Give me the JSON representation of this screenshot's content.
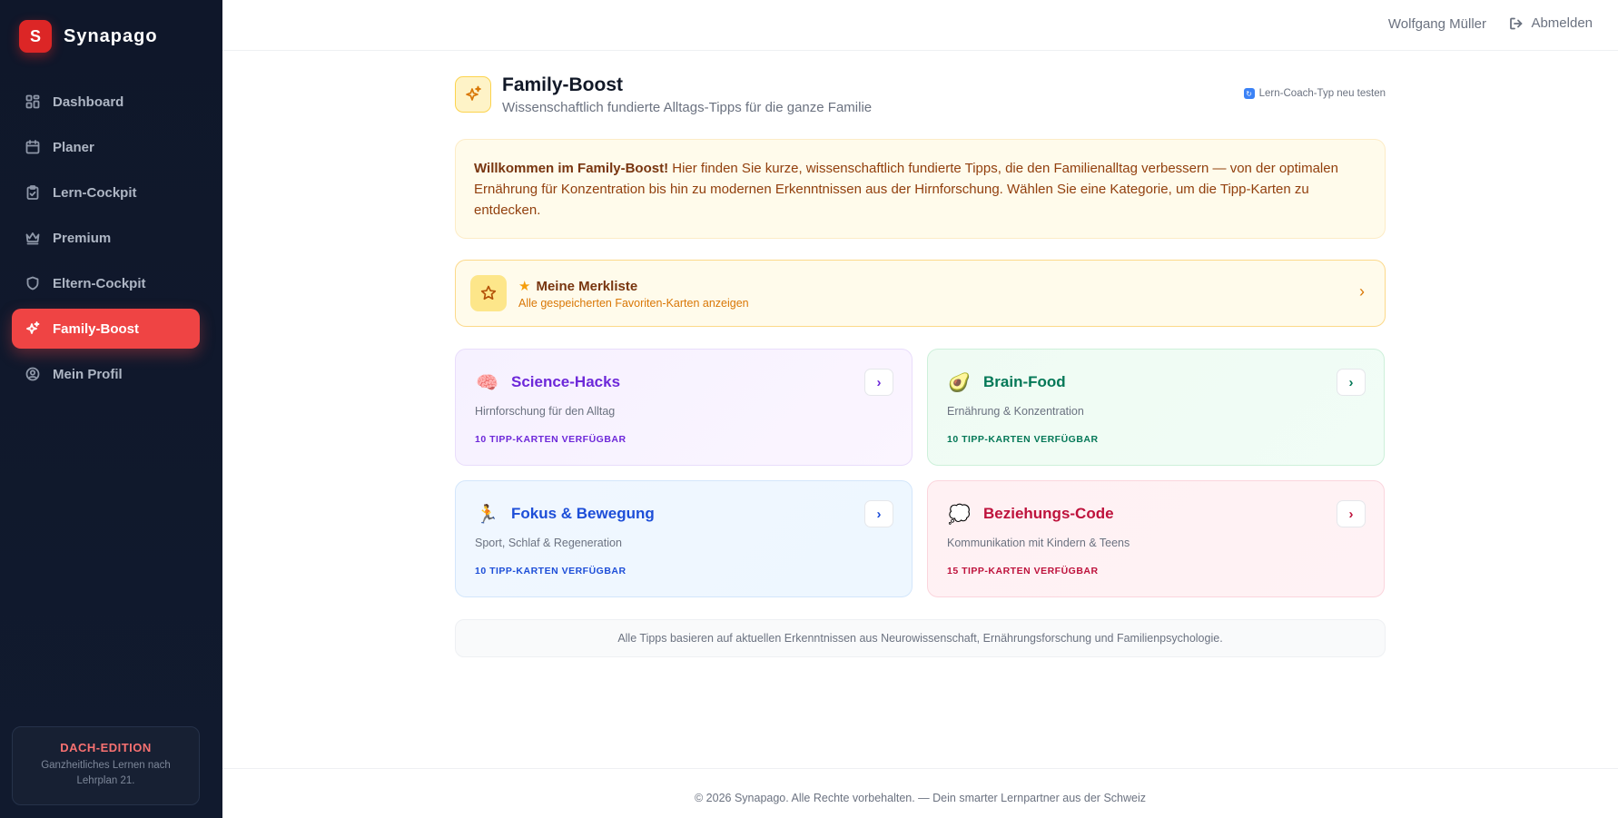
{
  "brand": {
    "logo_letter": "S",
    "name": "Synapago"
  },
  "sidebar": {
    "items": [
      {
        "label": "Dashboard",
        "icon": "grid-icon"
      },
      {
        "label": "Planer",
        "icon": "calendar-icon"
      },
      {
        "label": "Lern-Cockpit",
        "icon": "clipboard-icon"
      },
      {
        "label": "Premium",
        "icon": "crown-icon"
      },
      {
        "label": "Eltern-Cockpit",
        "icon": "shield-icon"
      },
      {
        "label": "Family-Boost",
        "icon": "sparkles-icon",
        "active": true
      },
      {
        "label": "Mein Profil",
        "icon": "user-circle-icon"
      }
    ],
    "edition": {
      "title": "DACH-EDITION",
      "subtitle": "Ganzheitliches Lernen nach Lehrplan 21."
    }
  },
  "header": {
    "user_name": "Wolfgang Müller",
    "logout_label": "Abmelden"
  },
  "page": {
    "title": "Family-Boost",
    "subtitle": "Wissenschaftlich fundierte Alltags-Tipps für die ganze Familie",
    "retest_label": "Lern-Coach-Typ neu testen"
  },
  "welcome": {
    "bold": "Willkommen im Family-Boost!",
    "text": " Hier finden Sie kurze, wissenschaftlich fundierte Tipps, die den Familienalltag verbessern — von der optimalen Ernährung für Konzentration bis hin zu modernen Erkenntnissen aus der Hirnforschung. Wählen Sie eine Kategorie, um die Tipp-Karten zu entdecken."
  },
  "merkliste": {
    "title": "Meine Merkliste",
    "subtitle": "Alle gespeicherten Favoriten-Karten anzeigen"
  },
  "categories": [
    {
      "emoji": "🧠",
      "title": "Science-Hacks",
      "subtitle": "Hirnforschung für den Alltag",
      "count": "10 TIPP-KARTEN VERFÜGBAR"
    },
    {
      "emoji": "🥑",
      "title": "Brain-Food",
      "subtitle": "Ernährung & Konzentration",
      "count": "10 TIPP-KARTEN VERFÜGBAR"
    },
    {
      "emoji": "🏃",
      "title": "Fokus & Bewegung",
      "subtitle": "Sport, Schlaf & Regeneration",
      "count": "10 TIPP-KARTEN VERFÜGBAR"
    },
    {
      "emoji": "💭",
      "title": "Beziehungs-Code",
      "subtitle": "Kommunikation mit Kindern & Teens",
      "count": "15 TIPP-KARTEN VERFÜGBAR"
    }
  ],
  "note": "Alle Tipps basieren auf aktuellen Erkenntnissen aus Neurowissenschaft, Ernährungsforschung und Familienpsychologie.",
  "footer": "© 2026 Synapago. Alle Rechte vorbehalten. — Dein smarter Lernpartner aus der Schweiz"
}
